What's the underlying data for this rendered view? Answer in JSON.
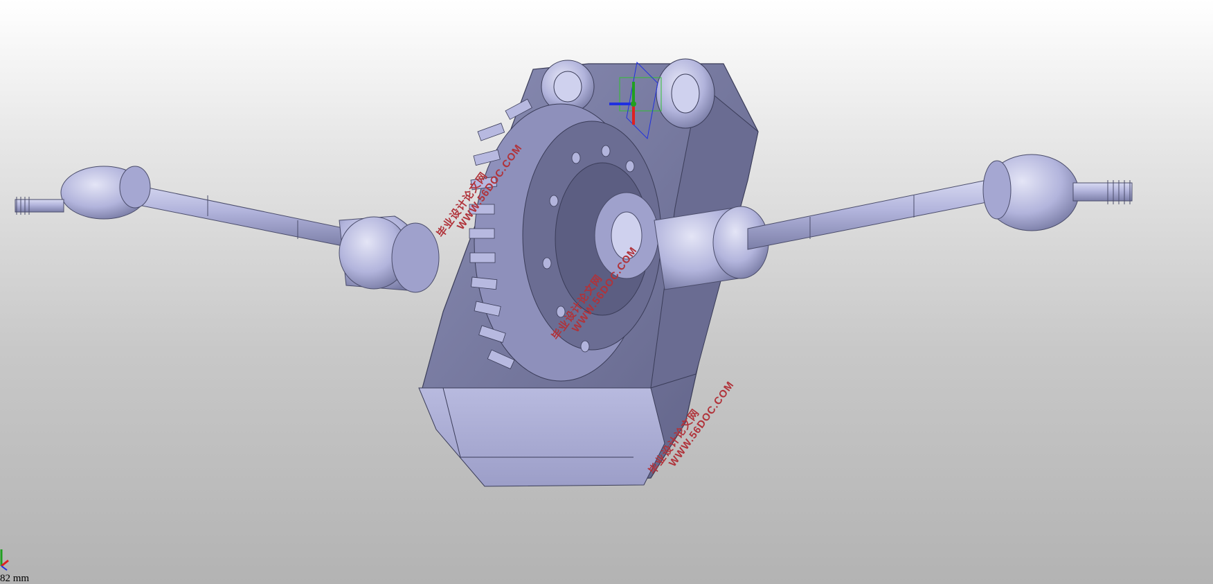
{
  "viewport": {
    "background_top": "#ffffff",
    "background_bottom": "#b3b3b3",
    "model_color": "#b2b4dc",
    "model_shadow": "#6f7193",
    "scale_text": "82 mm"
  },
  "watermarks": [
    {
      "cn": "毕业设计论文网",
      "url": "WWW.56DOC.COM"
    },
    {
      "cn": "毕业设计论文网",
      "url": "WWW.56DOC.COM"
    },
    {
      "cn": "毕业设计论文网",
      "url": "WWW.56DOC.COM"
    }
  ],
  "triad": {
    "x_color": "#e02020",
    "y_color": "#20a020",
    "z_color": "#2030e0"
  }
}
